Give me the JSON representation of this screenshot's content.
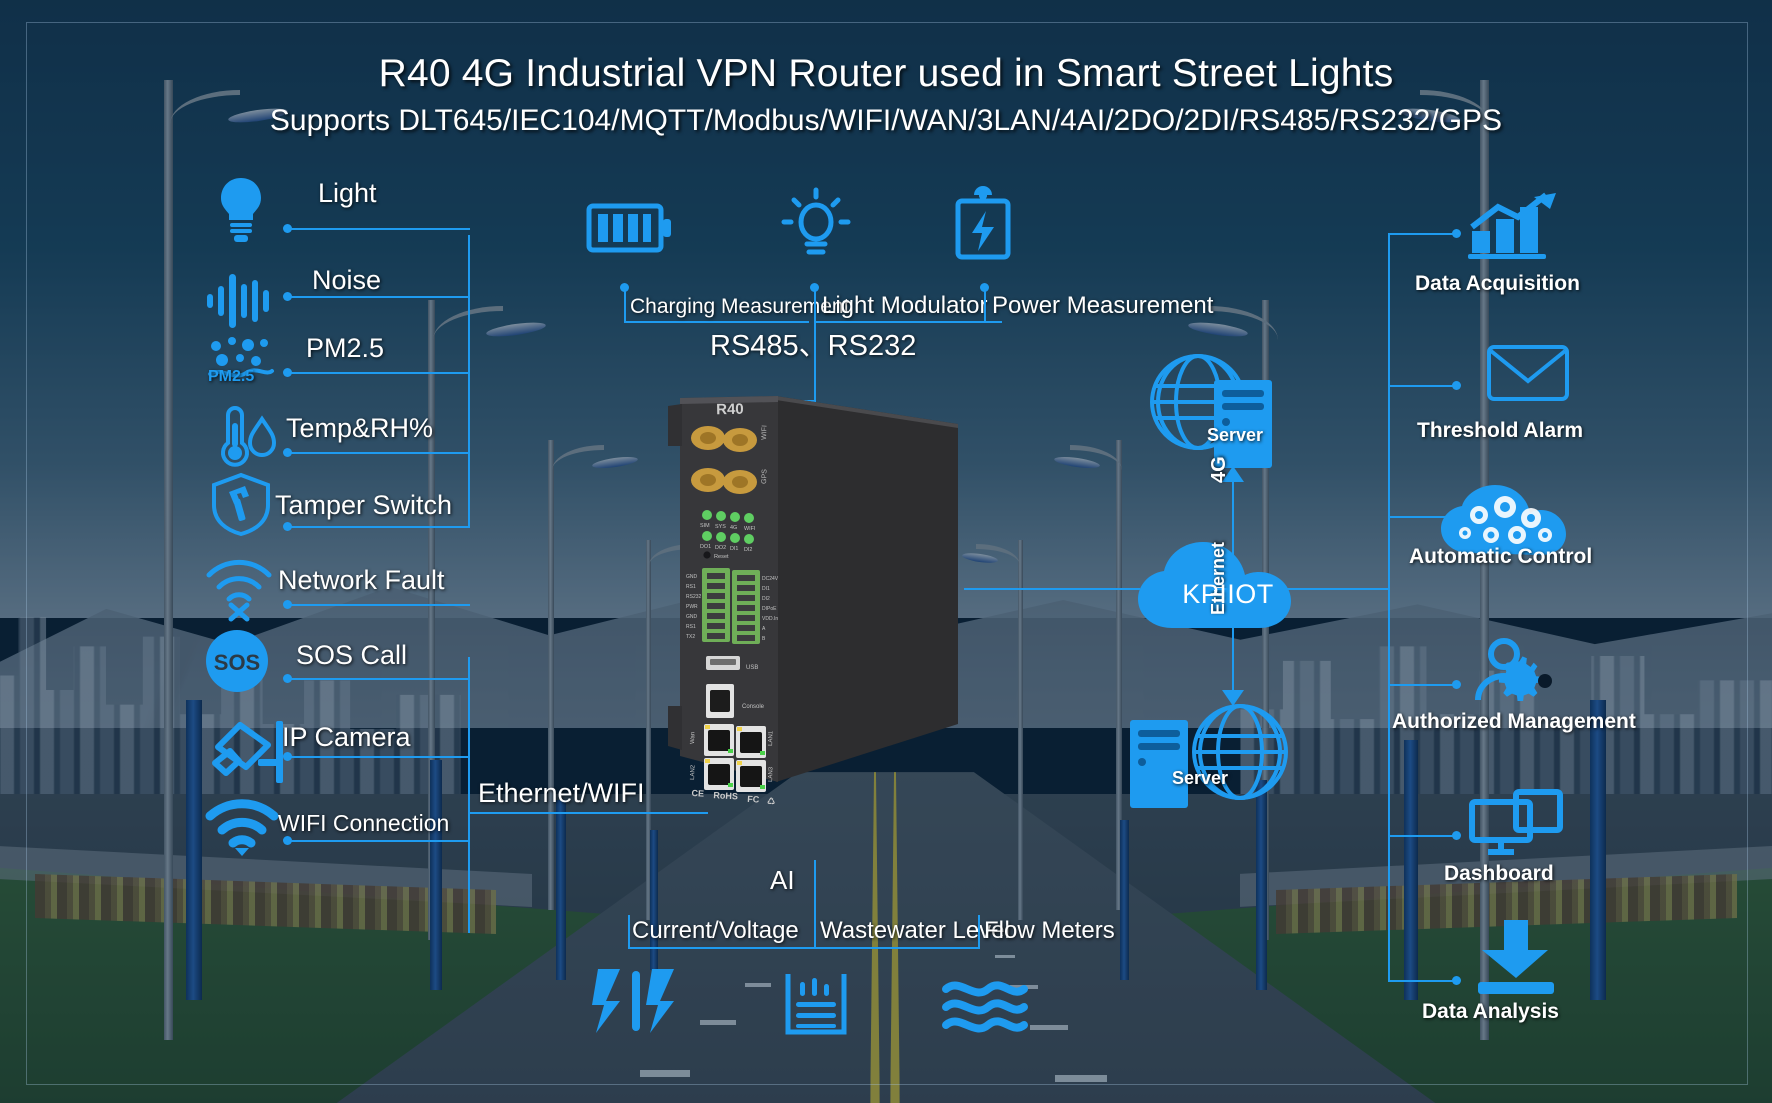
{
  "header": {
    "title": "R40 4G Industrial VPN Router used in Smart Street Lights",
    "subtitle": "Supports DLT645/IEC104/MQTT/Modbus/WIFI/WAN/3LAN/4AI/2DO/2DI/RS485/RS232/GPS"
  },
  "colors": {
    "accent": "#1e9bf0",
    "text": "#ffffff",
    "background_top": "#16374f",
    "pole_blue": "#2b66b6"
  },
  "left_sensors": [
    {
      "label": "Light",
      "icon": "lightbulb-icon"
    },
    {
      "label": "Noise",
      "icon": "sound-wave-icon"
    },
    {
      "label": "PM2.5",
      "icon": "pm25-icon",
      "icon_caption": "PM2.5"
    },
    {
      "label": "Temp&RH%",
      "icon": "thermometer-humidity-icon"
    },
    {
      "label": "Tamper Switch",
      "icon": "shield-hammer-icon"
    },
    {
      "label": "Network Fault",
      "icon": "wifi-fault-icon"
    },
    {
      "label": "SOS Call",
      "icon": "sos-icon",
      "icon_caption": "SOS"
    },
    {
      "label": "IP Camera",
      "icon": "cctv-camera-icon"
    },
    {
      "label": "WIFI Connection",
      "icon": "wifi-icon"
    }
  ],
  "top_measurements": [
    {
      "label": "Charging Measurement",
      "icon": "battery-level-icon"
    },
    {
      "label": "Light Modulator",
      "icon": "light-dimmer-icon"
    },
    {
      "label": "Power Measurement",
      "icon": "battery-bolt-icon"
    }
  ],
  "serial_bus_label": "RS485、RS232",
  "ethernet_label": "Ethernet/WIFI",
  "analog_input": {
    "group_label": "AI",
    "items": [
      {
        "label": "Current/Voltage",
        "icon": "current-voltage-icon"
      },
      {
        "label": "Wastewater Level",
        "icon": "water-level-icon"
      },
      {
        "label": "Flow Meters",
        "icon": "flow-meter-icon"
      }
    ]
  },
  "device": {
    "model": "R40",
    "port_labels_left": [
      "GND",
      "RS1",
      "RS232",
      "PWR",
      "GND",
      "RS1",
      "TX2"
    ],
    "port_labels_right": [
      "DC24V",
      "DI1",
      "DI2",
      "DIPoE",
      "VDD.In",
      "A",
      "B"
    ],
    "antenna_labels": [
      "WIFI",
      "GPS"
    ],
    "led_row1": [
      "SIM",
      "SYS",
      "4G",
      "WIFI"
    ],
    "led_row2": [
      "DO1",
      "DO2",
      "DI1",
      "DI2"
    ],
    "reset_label": "Reset",
    "usb_label": "USB",
    "console_label": "Console",
    "wan_label": "Wan",
    "lan_labels": [
      "LAN1",
      "LAN2",
      "LAN3"
    ],
    "certs": "CE RoHS FC"
  },
  "network": {
    "cloud_label": "KPIIOT",
    "uplink_label": "4G",
    "downlink_label": "Ethernet",
    "server_top_label": "Server",
    "server_bottom_label": "Server"
  },
  "platform_features": [
    {
      "label": "Data Acquisition",
      "icon": "bar-chart-growth-icon"
    },
    {
      "label": "Threshold Alarm",
      "icon": "envelope-icon"
    },
    {
      "label": "Automatic Control",
      "icon": "cloud-gears-icon"
    },
    {
      "label": "Authorized Management",
      "icon": "user-gear-icon"
    },
    {
      "label": "Dashboard",
      "icon": "monitor-icon"
    },
    {
      "label": "Data Analysis",
      "icon": "download-arrow-icon"
    }
  ]
}
